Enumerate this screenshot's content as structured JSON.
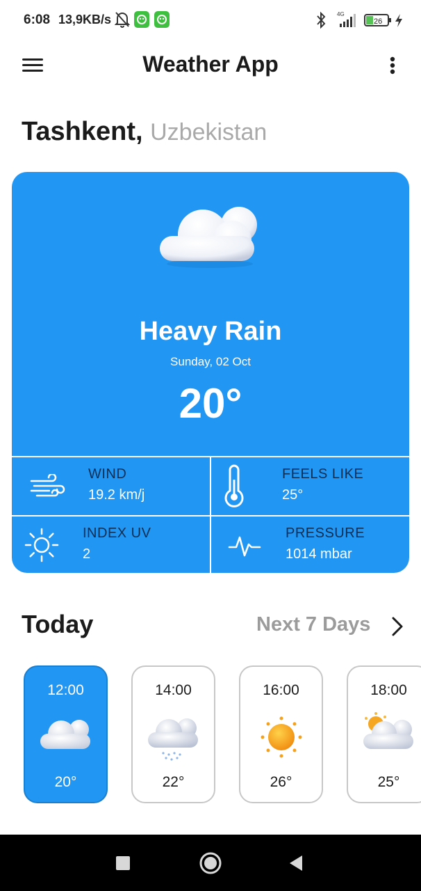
{
  "status_bar": {
    "time": "6:08",
    "speed": "13,9KB/s",
    "network": "4G",
    "battery": "26",
    "icons": [
      "bell-off-icon",
      "app-notification-icon",
      "app-notification-icon",
      "bluetooth-icon",
      "signal-icon",
      "battery-icon",
      "charging-icon"
    ]
  },
  "app_bar": {
    "title": "Weather App",
    "menu_icon": "hamburger-icon",
    "more_icon": "more-vertical-icon"
  },
  "location": {
    "city": "Tashkent,",
    "country": "Uzbekistan"
  },
  "current": {
    "icon": "cloud-icon",
    "condition": "Heavy Rain",
    "date": "Sunday, 02 Oct",
    "temperature": "20°",
    "stats": [
      {
        "icon": "wind-icon",
        "label": "WIND",
        "value": "19.2 km/j"
      },
      {
        "icon": "thermometer-icon",
        "label": "FEELS LIKE",
        "value": "25°"
      },
      {
        "icon": "sun-icon",
        "label": "INDEX UV",
        "value": "2"
      },
      {
        "icon": "pulse-icon",
        "label": "PRESSURE",
        "value": "1014 mbar"
      }
    ]
  },
  "today": {
    "title": "Today",
    "next_label": "Next 7 Days",
    "hours": [
      {
        "time": "12:00",
        "temp": "20°",
        "icon": "cloud-icon",
        "selected": true
      },
      {
        "time": "14:00",
        "temp": "22°",
        "icon": "cloud-rain-icon",
        "selected": false
      },
      {
        "time": "16:00",
        "temp": "26°",
        "icon": "sun-icon",
        "selected": false
      },
      {
        "time": "18:00",
        "temp": "25°",
        "icon": "sun-behind-cloud-icon",
        "selected": false
      }
    ]
  },
  "colors": {
    "accent": "#2196f3",
    "stat_label": "#0d2f55",
    "muted": "#9b9b9b"
  }
}
